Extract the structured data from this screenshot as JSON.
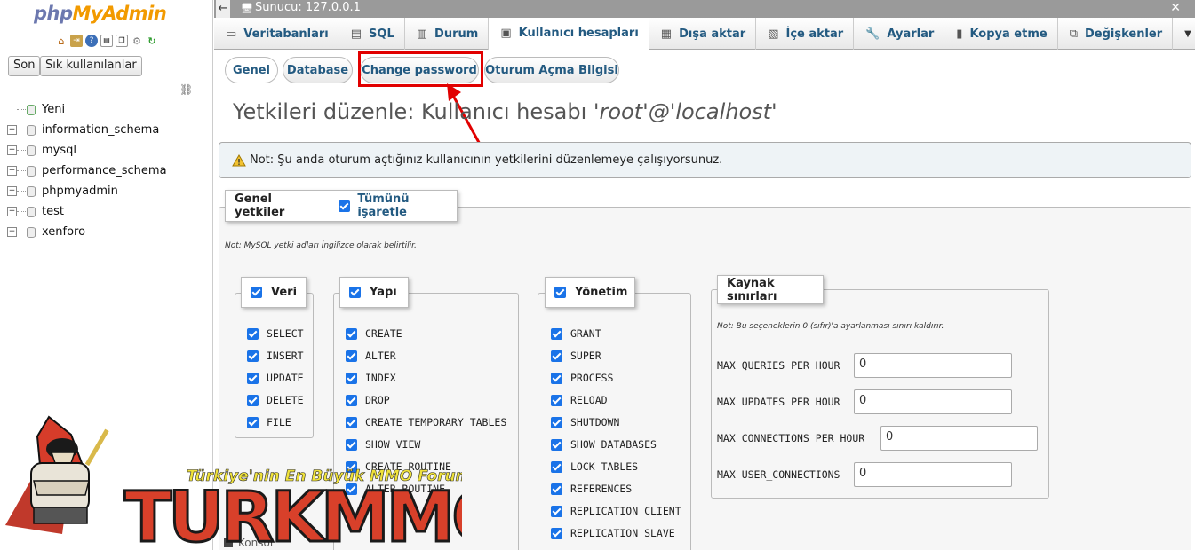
{
  "sidebar": {
    "logo_php": "php",
    "logo_myadmin": "MyAdmin",
    "recent_button": "Son",
    "favorites_button": "Sık kullanılanlar",
    "tree": [
      {
        "label": "Yeni",
        "type": "new"
      },
      {
        "label": "information_schema",
        "type": "db"
      },
      {
        "label": "mysql",
        "type": "db"
      },
      {
        "label": "performance_schema",
        "type": "db"
      },
      {
        "label": "phpmyadmin",
        "type": "db"
      },
      {
        "label": "test",
        "type": "db"
      },
      {
        "label": "xenforo",
        "type": "db-expanded"
      }
    ]
  },
  "topbar": {
    "server_label": "Sunucu: 127.0.0.1"
  },
  "tabs": [
    {
      "label": "Veritabanları",
      "icon": "database-icon"
    },
    {
      "label": "SQL",
      "icon": "sql-icon"
    },
    {
      "label": "Durum",
      "icon": "status-icon"
    },
    {
      "label": "Kullanıcı hesapları",
      "icon": "users-icon",
      "active": true
    },
    {
      "label": "Dışa aktar",
      "icon": "export-icon"
    },
    {
      "label": "İçe aktar",
      "icon": "import-icon"
    },
    {
      "label": "Ayarlar",
      "icon": "wrench-icon"
    },
    {
      "label": "Kopya etme",
      "icon": "replication-icon"
    },
    {
      "label": "Değişkenler",
      "icon": "variables-icon"
    },
    {
      "label": "Daha fazla",
      "icon": "chevron-down-icon"
    }
  ],
  "subtabs": [
    {
      "label": "Genel",
      "active": true
    },
    {
      "label": "Database"
    },
    {
      "label": "Change password",
      "highlighted": true
    },
    {
      "label": "Oturum Açma Bilgisi"
    }
  ],
  "page": {
    "title_prefix": "Yetkileri düzenle: Kullanıcı hesabı ",
    "title_user": "'root'@'localhost'",
    "notice": "Not: Şu anda oturum açtığınız kullanıcının yetkilerini düzenlemeye çalışıyorsunuz."
  },
  "global_privileges": {
    "legend": "Genel yetkiler",
    "check_all": "Tümünü işaretle",
    "note": "Not: MySQL yetki adları İngilizce olarak belirtilir.",
    "groups": {
      "data": {
        "legend": "Veri",
        "items": [
          "SELECT",
          "INSERT",
          "UPDATE",
          "DELETE",
          "FILE"
        ]
      },
      "structure": {
        "legend": "Yapı",
        "items": [
          "CREATE",
          "ALTER",
          "INDEX",
          "DROP",
          "CREATE TEMPORARY TABLES",
          "SHOW VIEW",
          "CREATE ROUTINE",
          "ALTER ROUTINE"
        ]
      },
      "admin": {
        "legend": "Yönetim",
        "items": [
          "GRANT",
          "SUPER",
          "PROCESS",
          "RELOAD",
          "SHUTDOWN",
          "SHOW DATABASES",
          "LOCK TABLES",
          "REFERENCES",
          "REPLICATION CLIENT",
          "REPLICATION SLAVE"
        ]
      }
    },
    "resource_limits": {
      "legend": "Kaynak sınırları",
      "note": "Not: Bu seçeneklerin 0 (sıfır)'a ayarlanması sınırı kaldırır.",
      "rows": [
        {
          "label": "MAX QUERIES PER HOUR",
          "value": "0"
        },
        {
          "label": "MAX UPDATES PER HOUR",
          "value": "0"
        },
        {
          "label": "MAX CONNECTIONS PER HOUR",
          "value": "0"
        },
        {
          "label": "MAX USER_CONNECTIONS",
          "value": "0"
        }
      ]
    }
  },
  "console": {
    "label": "Konsol"
  },
  "watermark": {
    "tagline": "Türkiye'nin En Büyük MMO Forumu",
    "brand": "TURKMMO"
  }
}
